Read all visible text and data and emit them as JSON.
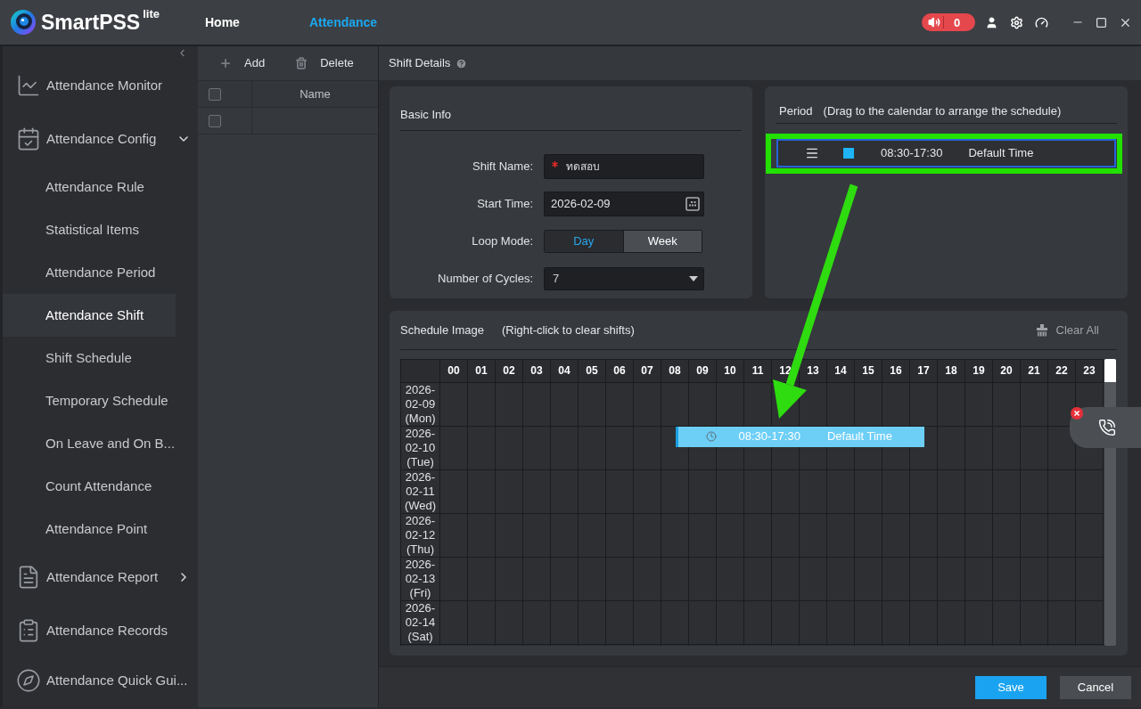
{
  "app": {
    "name": "SmartPSS",
    "edition": "lite"
  },
  "nav_tabs": [
    {
      "label": "Home",
      "selected": false
    },
    {
      "label": "Attendance",
      "selected": true
    }
  ],
  "alarm": {
    "count": "0"
  },
  "sidebar": {
    "items": [
      {
        "label": "Attendance Monitor",
        "selected": false
      },
      {
        "label": "Attendance Config",
        "selected": false,
        "expanded": true,
        "children": [
          {
            "label": "Attendance Rule",
            "selected": false
          },
          {
            "label": "Statistical Items",
            "selected": false
          },
          {
            "label": "Attendance Period",
            "selected": false
          },
          {
            "label": "Attendance Shift",
            "selected": true
          },
          {
            "label": "Shift Schedule",
            "selected": false
          },
          {
            "label": "Temporary Schedule",
            "selected": false
          },
          {
            "label": "On Leave and On B...",
            "selected": false
          },
          {
            "label": "Count Attendance",
            "selected": false
          },
          {
            "label": "Attendance Point",
            "selected": false
          }
        ]
      },
      {
        "label": "Attendance Report",
        "selected": false,
        "expanded": false
      },
      {
        "label": "Attendance Records",
        "selected": false
      },
      {
        "label": "Attendance Quick Gui...",
        "selected": false
      }
    ]
  },
  "shift_list": {
    "toolbar": [
      {
        "label": "Add"
      },
      {
        "label": "Delete"
      }
    ],
    "header_checked": false,
    "columns": [
      {
        "label": "Name"
      }
    ],
    "rows": [
      {
        "checked": false
      }
    ]
  },
  "shift_details": {
    "title": "Shift Details"
  },
  "basic_info": {
    "title": "Basic Info",
    "shift_name": {
      "label": "Shift Name:",
      "value": "ทดสอบ",
      "required": true
    },
    "start_time": {
      "label": "Start Time:",
      "value": "2026-02-09"
    },
    "loop_mode": {
      "label": "Loop Mode:",
      "options": [
        {
          "label": "Day",
          "selected": true
        },
        {
          "label": "Week",
          "selected": false
        }
      ]
    },
    "cycles": {
      "label": "Number of Cycles:",
      "value": "7"
    }
  },
  "period": {
    "title": "Period",
    "hint": "(Drag to the calendar to arrange the schedule)",
    "items": [
      {
        "time": "08:30-17:30",
        "name": "Default Time",
        "color": "#1eb4f5",
        "selected": true
      }
    ]
  },
  "schedule": {
    "title": "Schedule Image",
    "hint": "(Right-click to clear shifts)",
    "clear_label": "Clear All",
    "hours": [
      "00",
      "01",
      "02",
      "03",
      "04",
      "05",
      "06",
      "07",
      "08",
      "09",
      "10",
      "11",
      "12",
      "13",
      "14",
      "15",
      "16",
      "17",
      "18",
      "19",
      "20",
      "21",
      "22",
      "23"
    ],
    "rows": [
      {
        "date": "2026-02-09 (Mon)"
      },
      {
        "date": "2026-02-10 (Tue)",
        "shifts": [
          {
            "time": "08:30-17:30",
            "name": "Default Time"
          }
        ]
      },
      {
        "date": "2026-02-11 (Wed)"
      },
      {
        "date": "2026-02-12 (Thu)"
      },
      {
        "date": "2026-02-13 (Fri)"
      },
      {
        "date": "2026-02-14 (Sat)"
      }
    ]
  },
  "footer": {
    "buttons": [
      {
        "label": "Save",
        "kind": "primary"
      },
      {
        "label": "Cancel",
        "kind": "secondary"
      }
    ]
  }
}
